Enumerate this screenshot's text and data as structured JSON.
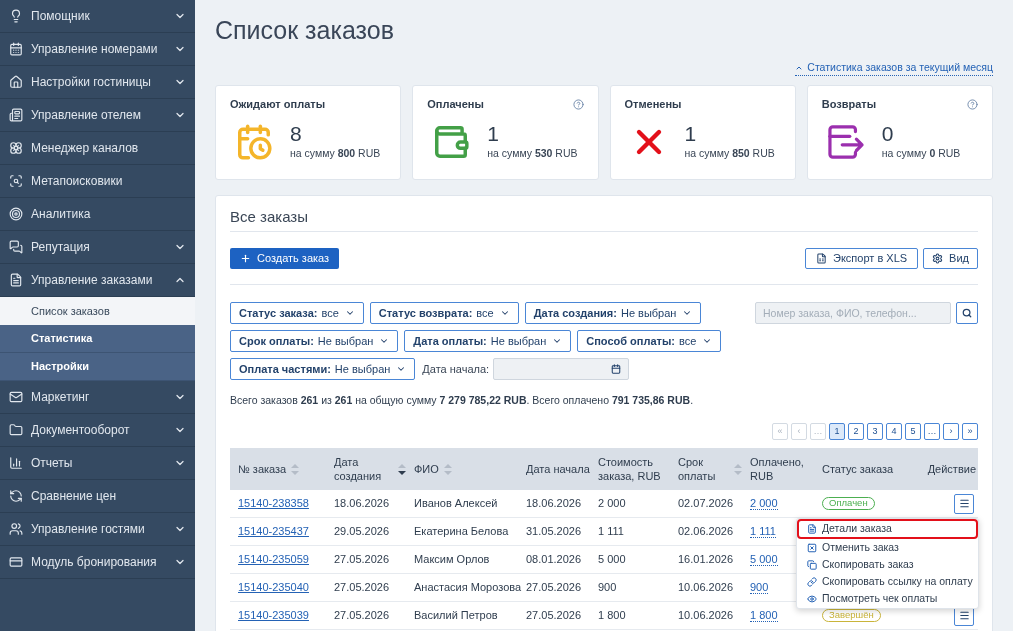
{
  "sidebar": {
    "items": [
      {
        "label": "Помощник",
        "kind": "group",
        "expanded": false
      },
      {
        "label": "Управление номерами",
        "kind": "group",
        "expanded": false
      },
      {
        "label": "Настройки гостиницы",
        "kind": "group",
        "expanded": false
      },
      {
        "label": "Управление отелем",
        "kind": "group",
        "expanded": false
      },
      {
        "label": "Менеджер каналов",
        "kind": "link"
      },
      {
        "label": "Метапоисковики",
        "kind": "link"
      },
      {
        "label": "Аналитика",
        "kind": "link"
      },
      {
        "label": "Репутация",
        "kind": "group",
        "expanded": false
      },
      {
        "label": "Управление заказами",
        "kind": "group",
        "expanded": true,
        "children": [
          {
            "label": "Список заказов",
            "selected": true
          },
          {
            "label": "Статистика",
            "selected": false
          },
          {
            "label": "Настройки",
            "selected": false
          }
        ]
      },
      {
        "label": "Маркетинг",
        "kind": "group",
        "expanded": false
      },
      {
        "label": "Документооборот",
        "kind": "group",
        "expanded": false
      },
      {
        "label": "Отчеты",
        "kind": "group",
        "expanded": false
      },
      {
        "label": "Сравнение цен",
        "kind": "link"
      },
      {
        "label": "Управление гостями",
        "kind": "group",
        "expanded": false
      },
      {
        "label": "Модуль бронирования",
        "kind": "group",
        "expanded": false
      }
    ]
  },
  "header": {
    "title": "Список заказов",
    "stats_link": "Статистика заказов за текущий месяц"
  },
  "stats": [
    {
      "title": "Ожидают оплаты",
      "count": "8",
      "sum": "на сумму **800** RUB",
      "help": false
    },
    {
      "title": "Оплачены",
      "count": "1",
      "sum": "на сумму **530** RUB",
      "help": true
    },
    {
      "title": "Отменены",
      "count": "1",
      "sum": "на сумму **850** RUB",
      "help": false
    },
    {
      "title": "Возвраты",
      "count": "0",
      "sum": "на сумму **0** RUB",
      "help": true
    }
  ],
  "orders": {
    "title": "Все заказы",
    "create_button": "Создать заказ",
    "export_button": "Экспорт в XLS",
    "view_button": "Вид",
    "filter_rows": [
      [
        {
          "label": "Статус заказа:",
          "value": "все"
        },
        {
          "label": "Статус возврата:",
          "value": "все"
        },
        {
          "label": "Дата создания:",
          "value": "Не выбран"
        }
      ],
      [
        {
          "label": "Срок оплаты:",
          "value": "Не выбран"
        },
        {
          "label": "Дата оплаты:",
          "value": "Не выбран"
        },
        {
          "label": "Способ оплаты:",
          "value": "все"
        }
      ],
      [
        {
          "label": "Оплата частями:",
          "value": "Не выбран"
        }
      ]
    ],
    "search": {
      "placeholder": "Номер заказа, ФИО, телефон..."
    },
    "start_date": {
      "label": "Дата начала:"
    },
    "summary": "Всего заказов **261** из **261** на общую сумму **7 279 785,22 RUB**. Всего оплачено **791 735,86 RUB**.",
    "pagination": [
      {
        "label": "«",
        "selected": false,
        "disabled": true
      },
      {
        "label": "‹",
        "selected": false,
        "disabled": true
      },
      {
        "label": "…",
        "selected": false,
        "disabled": true
      },
      {
        "label": "1",
        "selected": true,
        "disabled": false
      },
      {
        "label": "2",
        "selected": false,
        "disabled": false
      },
      {
        "label": "3",
        "selected": false,
        "disabled": false
      },
      {
        "label": "4",
        "selected": false,
        "disabled": false
      },
      {
        "label": "5",
        "selected": false,
        "disabled": false
      },
      {
        "label": "…",
        "selected": false,
        "disabled": false
      },
      {
        "label": "›",
        "selected": false,
        "disabled": false
      },
      {
        "label": "»",
        "selected": false,
        "disabled": false
      }
    ],
    "table": {
      "columns": [
        {
          "label": "№ заказа",
          "sorted": false
        },
        {
          "label": "Дата создания",
          "sorted": true
        },
        {
          "label": "ФИО",
          "sorted": false
        },
        {
          "label": "Дата начала"
        },
        {
          "label": "Стоимость заказа, RUB"
        },
        {
          "label": "Срок оплаты",
          "sorted": false
        },
        {
          "label": "Оплачено, RUB"
        },
        {
          "label": "Статус заказа"
        },
        {
          "label": "Действие"
        }
      ],
      "rows": [
        {
          "order": "15140-238358",
          "created": "18.06.2026",
          "name": "Иванов Алексей",
          "start": "18.06.2026",
          "cost": "2 000",
          "due": "02.07.2026",
          "paid": "2 000",
          "status": {
            "label": "Оплачен",
            "color": "#4caf50"
          },
          "menu": {
            "items": [
              {
                "label": "Детали заказа",
                "highlighted": true
              },
              {
                "label": "Отменить заказ",
                "highlighted": false
              },
              {
                "label": "Скопировать заказ",
                "highlighted": false
              },
              {
                "label": "Скопировать ссылку на оплату",
                "highlighted": false
              },
              {
                "label": "Посмотреть чек оплаты",
                "highlighted": false
              }
            ]
          }
        },
        {
          "order": "15140-235437",
          "created": "29.05.2026",
          "name": "Екатерина Белова",
          "start": "31.05.2026",
          "cost": "1 111",
          "due": "02.06.2026",
          "paid": "1 111"
        },
        {
          "order": "15140-235059",
          "created": "27.05.2026",
          "name": "Максим Орлов",
          "start": "08.01.2026",
          "cost": "5 000",
          "due": "16.01.2026",
          "paid": "5 000"
        },
        {
          "order": "15140-235040",
          "created": "27.05.2026",
          "name": "Анастасия Морозова",
          "start": "27.05.2026",
          "cost": "900",
          "due": "10.06.2026",
          "paid": "900"
        },
        {
          "order": "15140-235039",
          "created": "27.05.2026",
          "name": "Василий Петров",
          "start": "27.05.2026",
          "cost": "1 800",
          "due": "10.06.2026",
          "paid": "1 800",
          "status": {
            "label": "Завершён",
            "color": "#c9b43a"
          }
        }
      ]
    }
  }
}
